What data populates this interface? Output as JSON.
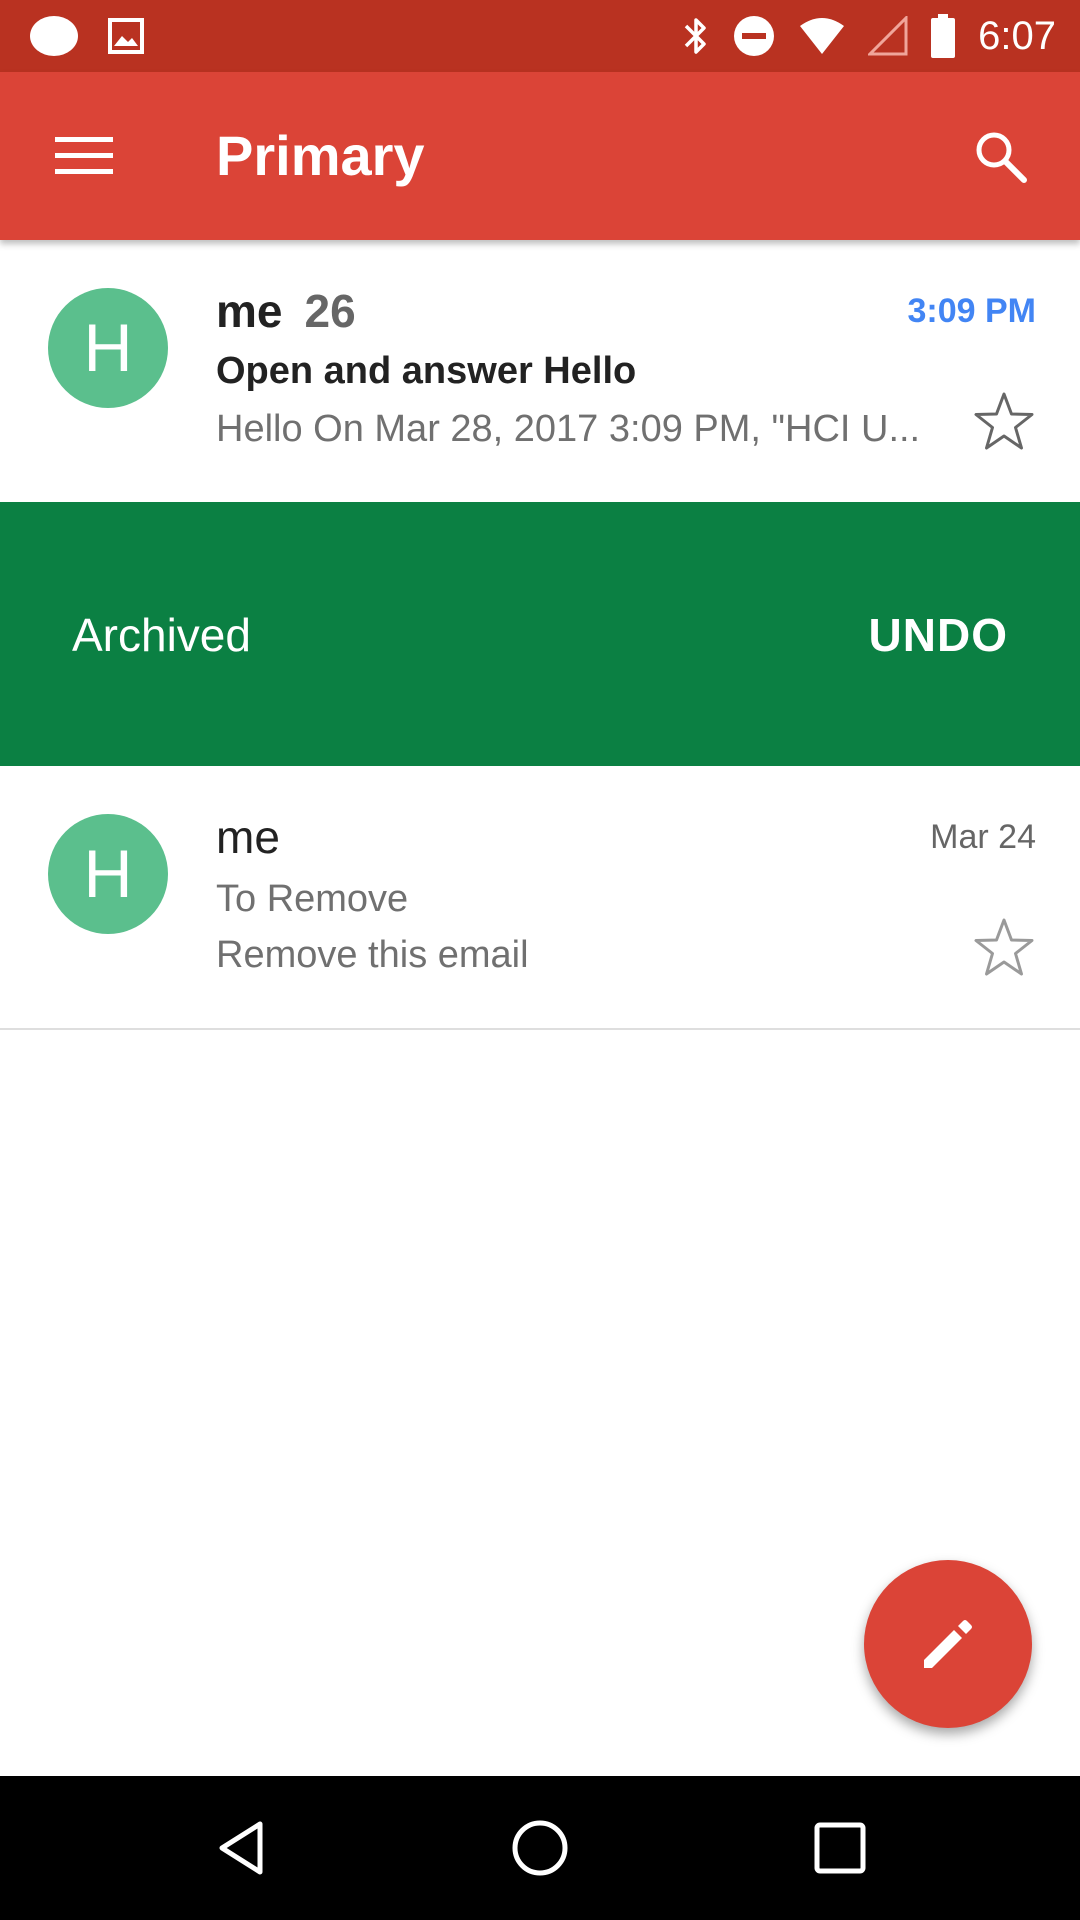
{
  "status_bar": {
    "time": "6:07"
  },
  "app_bar": {
    "title": "Primary"
  },
  "emails": [
    {
      "avatar_letter": "H",
      "sender": "me",
      "thread_count": "26",
      "time": "3:09 PM",
      "subject": "Open and answer Hello",
      "snippet": "Hello On Mar 28, 2017 3:09 PM, \"HCI U...",
      "unread": true
    },
    {
      "avatar_letter": "H",
      "sender": "me",
      "time": "Mar 24",
      "subject": "To Remove",
      "snippet": "Remove this email",
      "unread": false
    }
  ],
  "snackbar": {
    "message": "Archived",
    "action": "UNDO"
  },
  "colors": {
    "status_bar": "#b93221",
    "app_bar": "#db4437",
    "snackbar": "#0b8043",
    "avatar": "#5bbf8d",
    "unread_time": "#4285f4",
    "fab": "#db4437"
  },
  "icons": [
    "menu-icon",
    "search-icon",
    "star-icon",
    "pencil-icon",
    "back-icon",
    "home-icon",
    "recents-icon"
  ]
}
